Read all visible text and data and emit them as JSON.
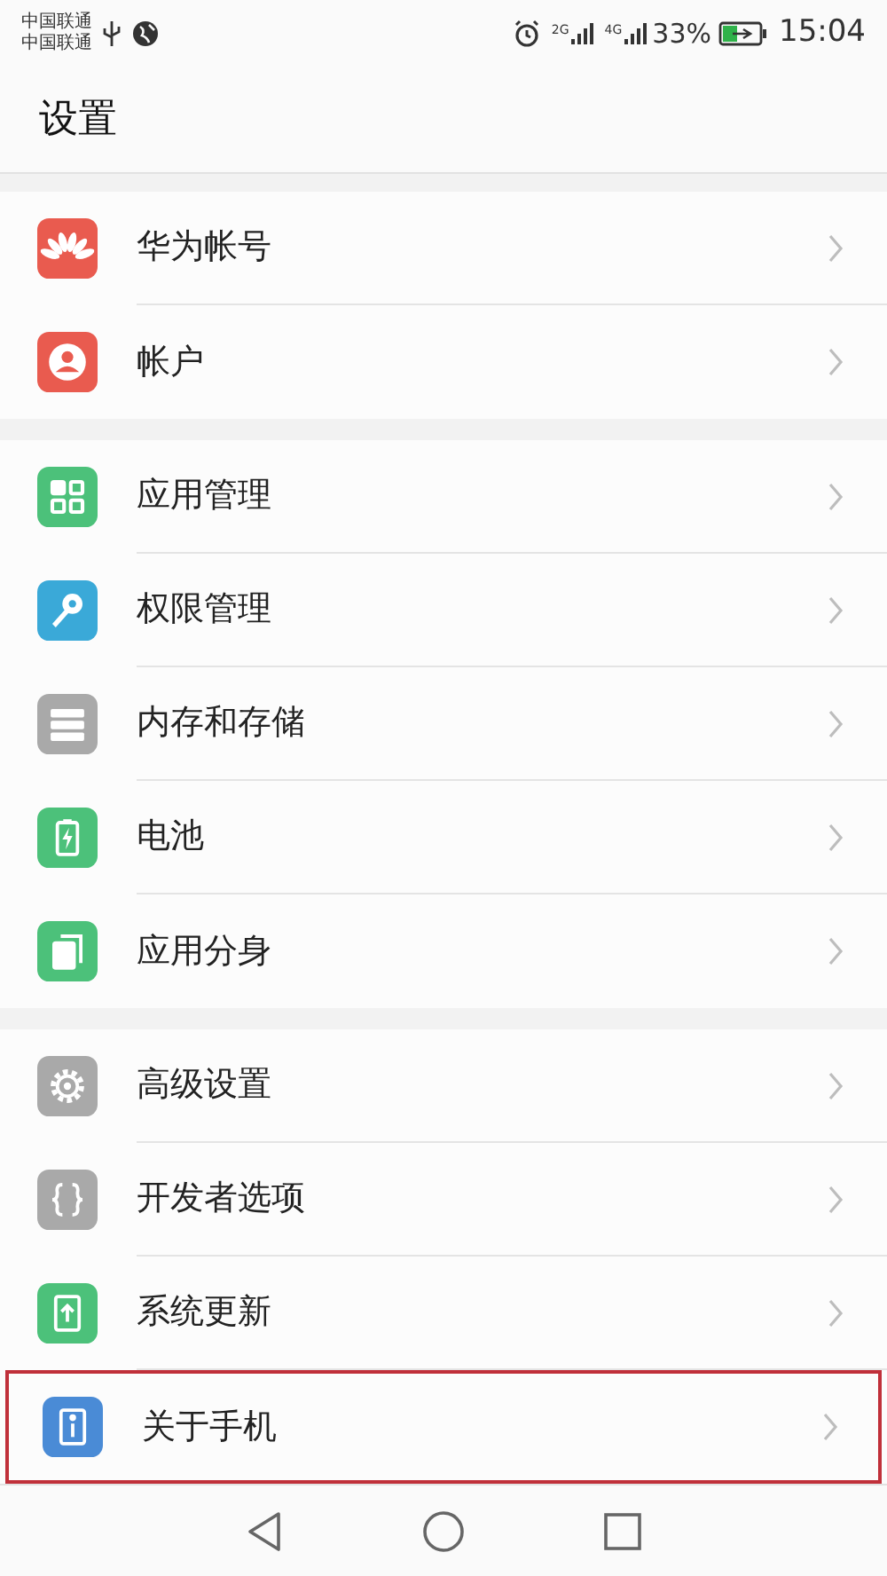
{
  "status_bar": {
    "carriers": [
      "中国联通",
      "中国联通"
    ],
    "networks": [
      "2G",
      "4G"
    ],
    "battery": "33%",
    "time": "15:04"
  },
  "title": "设置",
  "groups": [
    {
      "items": [
        {
          "label": "华为帐号",
          "kind": "petals",
          "color": "#e95b4f",
          "selected": false
        },
        {
          "label": "帐户",
          "kind": "person",
          "color": "#e95b4f",
          "selected": false
        }
      ]
    },
    {
      "items": [
        {
          "label": "应用管理",
          "kind": "grid",
          "color": "#4cc17a",
          "selected": false
        },
        {
          "label": "权限管理",
          "kind": "key",
          "color": "#3aa9d8",
          "selected": false
        },
        {
          "label": "内存和存储",
          "kind": "storage",
          "color": "#a9a9a9",
          "selected": false
        },
        {
          "label": "电池",
          "kind": "battery",
          "color": "#4cc17a",
          "selected": false
        },
        {
          "label": "应用分身",
          "kind": "twin",
          "color": "#4cc17a",
          "selected": false
        }
      ]
    },
    {
      "items": [
        {
          "label": "高级设置",
          "kind": "gear",
          "color": "#a9a9a9",
          "selected": false
        },
        {
          "label": "开发者选项",
          "kind": "braces",
          "color": "#a9a9a9",
          "selected": false
        },
        {
          "label": "系统更新",
          "kind": "update",
          "color": "#4cc17a",
          "selected": false
        },
        {
          "label": "关于手机",
          "kind": "info",
          "color": "#4a8bd6",
          "selected": true
        }
      ]
    }
  ]
}
